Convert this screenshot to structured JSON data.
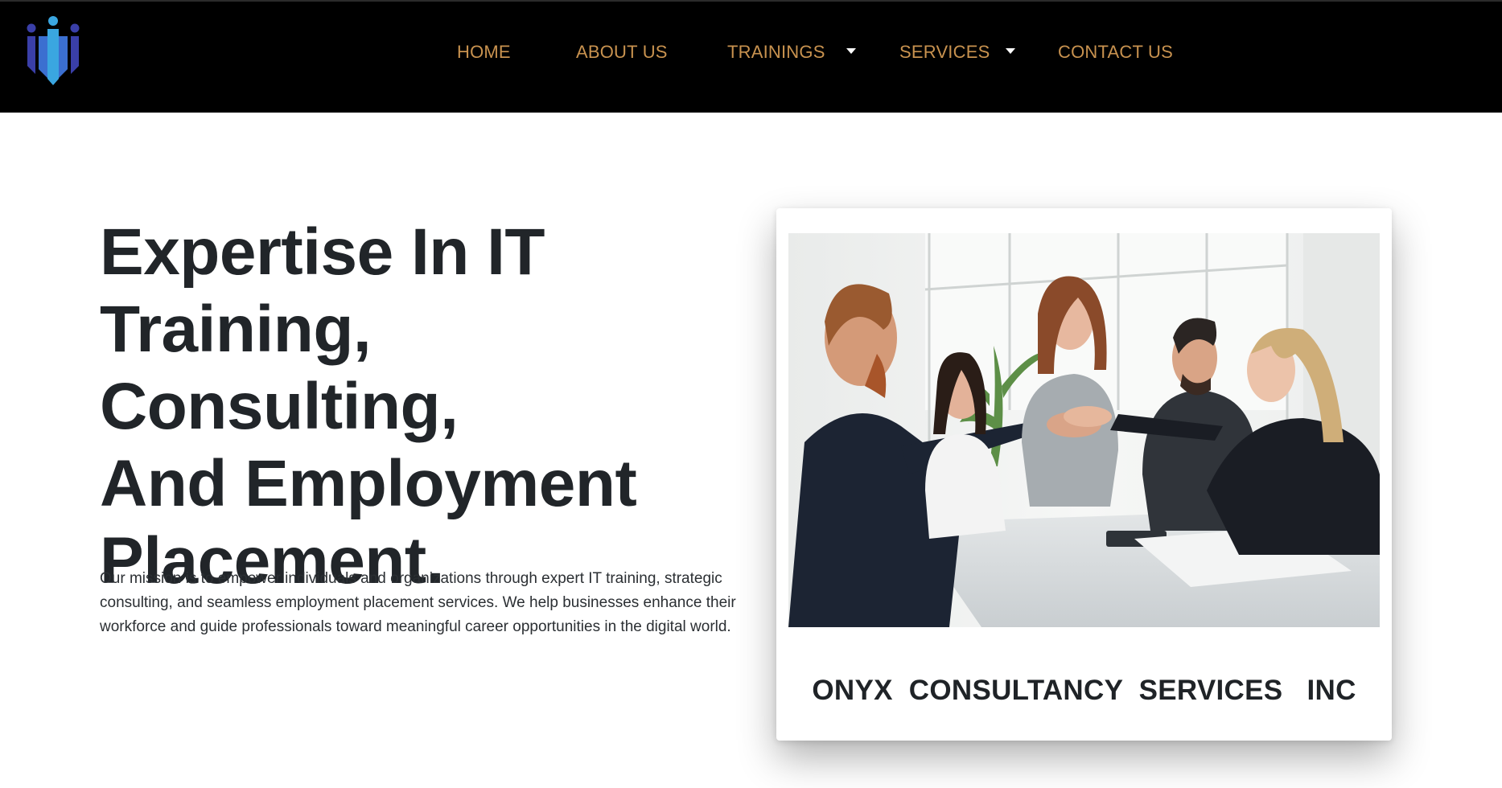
{
  "brand": {
    "logo_icon": "people-group-logo-icon",
    "colors": {
      "logo_dark": "#3a3fa8",
      "logo_light": "#3aa6e0"
    }
  },
  "nav": {
    "items": [
      {
        "label": "HOME"
      },
      {
        "label": "ABOUT US"
      },
      {
        "label": "TRAININGS",
        "has_dropdown": true
      },
      {
        "label": "SERVICES",
        "has_dropdown": true
      },
      {
        "label": "CONTACT US"
      }
    ],
    "dropdown_icon": "caret-down-icon",
    "colors": {
      "background": "#000000",
      "link": "#c8924f",
      "caret": "#ffffff"
    }
  },
  "hero": {
    "headline_lines": [
      "Expertise In IT",
      "Training, Consulting,",
      "And Employment",
      "Placement."
    ],
    "mission": "Our mission is to empower individuals and organizations through expert IT training, strategic consulting, and seamless employment placement services. We help businesses enhance their workforce and guide professionals toward meaningful career opportunities in the digital world."
  },
  "card": {
    "photo_subject": "team-hands-together-photo",
    "title": "ONYX  CONSULTANCY  SERVICES   INC"
  }
}
